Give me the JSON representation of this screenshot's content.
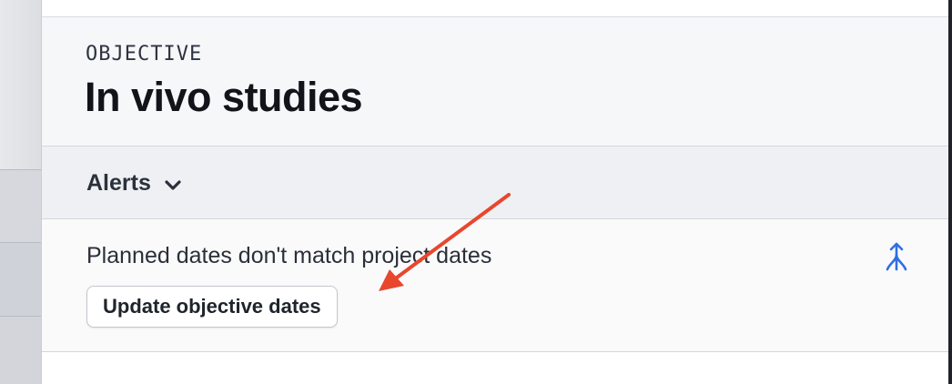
{
  "objective": {
    "eyebrow": "OBJECTIVE",
    "title": "In vivo studies"
  },
  "alerts": {
    "label": "Alerts",
    "toggle_icon": "chevron-down-icon",
    "items": [
      {
        "message": "Planned dates don't match project dates",
        "action_label": "Update objective dates",
        "action_icon": "merge-icon"
      }
    ]
  },
  "colors": {
    "accent_icon": "#2f6fe0",
    "annotation_arrow": "#e8472e"
  }
}
